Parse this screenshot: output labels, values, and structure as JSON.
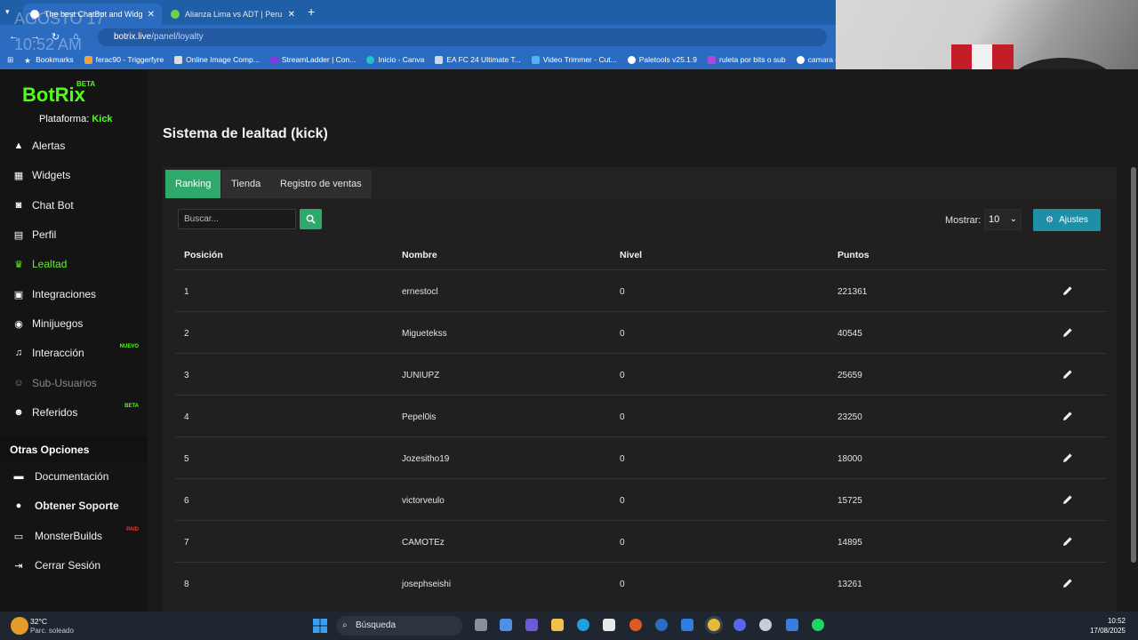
{
  "browser": {
    "tabs": [
      {
        "label": "The best ChatBot and Widgets",
        "active": true
      },
      {
        "label": "Alianza Lima vs ADT | Peru Liga",
        "active": false
      }
    ],
    "url_host": "botrix.live",
    "url_path": "/panel/loyalty",
    "overlay_date": "AGOSTO 17",
    "overlay_time": "10:52 AM",
    "bookmarks": [
      "Bookmarks",
      "ferac90 - Triggerfyre",
      "Online Image Comp...",
      "StreamLadder | Con...",
      "Inicio - Canva",
      "EA FC 24 Ultimate T...",
      "Video Trimmer - Cut...",
      "Paletools v25.1.9",
      "ruleta por bits o sub",
      "camara cel"
    ]
  },
  "app": {
    "logo": "BotRix",
    "logo_badge": "BETA",
    "platform_label": "Plataforma:",
    "platform_value": "Kick",
    "accent_color": "#53fc18",
    "sidebar": [
      {
        "label": "Alertas",
        "icon": "warning-icon"
      },
      {
        "label": "Widgets",
        "icon": "grid-icon"
      },
      {
        "label": "Chat Bot",
        "icon": "robot-icon"
      },
      {
        "label": "Perfil",
        "icon": "id-card-icon"
      },
      {
        "label": "Lealtad",
        "icon": "trophy-icon",
        "active": true
      },
      {
        "label": "Integraciones",
        "icon": "plug-icon"
      },
      {
        "label": "Minijuegos",
        "icon": "gamepad-icon"
      },
      {
        "label": "Interacción",
        "icon": "music-icon",
        "badge": "NUEVO"
      },
      {
        "label": "Sub-Usuarios",
        "icon": "users-icon",
        "disabled": true
      },
      {
        "label": "Referidos",
        "icon": "users-group-icon",
        "badge": "BETA"
      }
    ],
    "other_options_title": "Otras Opciones",
    "other_options": [
      {
        "label": "Documentación",
        "icon": "book-icon"
      },
      {
        "label": "Obtener Soporte",
        "icon": "help-icon"
      },
      {
        "label": "MonsterBuilds",
        "icon": "laptop-icon",
        "badge": "PAID"
      },
      {
        "label": "Cerrar Sesión",
        "icon": "logout-icon"
      }
    ],
    "page_title": "Sistema de lealtad (kick)",
    "tabs": [
      "Ranking",
      "Tienda",
      "Registro de ventas"
    ],
    "search_placeholder": "Buscar...",
    "show_label": "Mostrar:",
    "show_value": "10",
    "settings_label": "Ajustes",
    "table": {
      "headers": [
        "Posición",
        "Nombre",
        "Nivel",
        "Puntos"
      ],
      "rows": [
        [
          "1",
          "ernestocl",
          "0",
          "221361"
        ],
        [
          "2",
          "Miguetekss",
          "0",
          "40545"
        ],
        [
          "3",
          "JUNIUPZ",
          "0",
          "25659"
        ],
        [
          "4",
          "Pepel0is",
          "0",
          "23250"
        ],
        [
          "5",
          "Jozesitho19",
          "0",
          "18000"
        ],
        [
          "6",
          "victorveulo",
          "0",
          "15725"
        ],
        [
          "7",
          "CAMOTEz",
          "0",
          "14895"
        ],
        [
          "8",
          "josephseishi",
          "0",
          "13261"
        ]
      ]
    }
  },
  "taskbar": {
    "temperature": "32°C",
    "weather": "Parc. soleado",
    "search": "Búsqueda",
    "time": "10:52",
    "date": "17/08/2025"
  }
}
